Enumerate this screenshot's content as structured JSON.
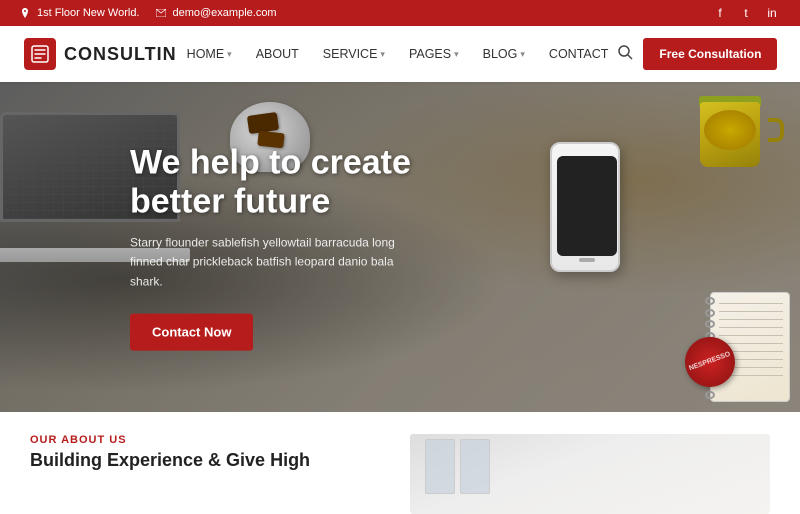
{
  "topbar": {
    "address": "1st Floor New World.",
    "email": "demo@example.com",
    "social": {
      "facebook": "f",
      "twitter": "t",
      "instagram": "in"
    }
  },
  "navbar": {
    "logo_text": "CONSULTIN",
    "logo_icon": "📋",
    "links": [
      {
        "label": "HOME",
        "has_dropdown": true
      },
      {
        "label": "ABOUT",
        "has_dropdown": false
      },
      {
        "label": "SERVICE",
        "has_dropdown": true
      },
      {
        "label": "PAGES",
        "has_dropdown": true
      },
      {
        "label": "BLOG",
        "has_dropdown": true
      },
      {
        "label": "CONTACT",
        "has_dropdown": false
      }
    ],
    "cta_button": "Free Consultation"
  },
  "hero": {
    "title_line1": "We help to create",
    "title_line2": "better future",
    "subtitle": "Starry flounder sablefish yellowtail barracuda long finned char prickleback batfish leopard danio bala shark.",
    "cta_button": "Contact Now",
    "red_circle_text": "NESPRESSO"
  },
  "about": {
    "label": "OUR ABOUT US",
    "title_line1": "Building Experience & Give High"
  }
}
